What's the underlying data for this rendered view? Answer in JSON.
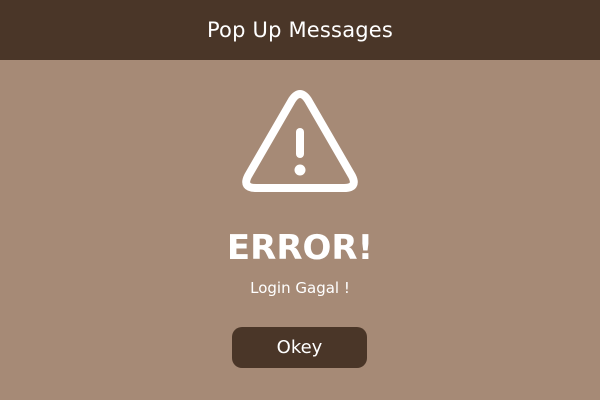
{
  "header": {
    "title": "Pop Up Messages"
  },
  "dialog": {
    "icon": "warning-triangle-icon",
    "title": "ERROR!",
    "message": "Login Gagal !",
    "button_label": "Okey"
  },
  "colors": {
    "header_bg": "#4a3628",
    "body_bg": "#a68a76",
    "button_bg": "#4a3628",
    "text": "#ffffff"
  }
}
